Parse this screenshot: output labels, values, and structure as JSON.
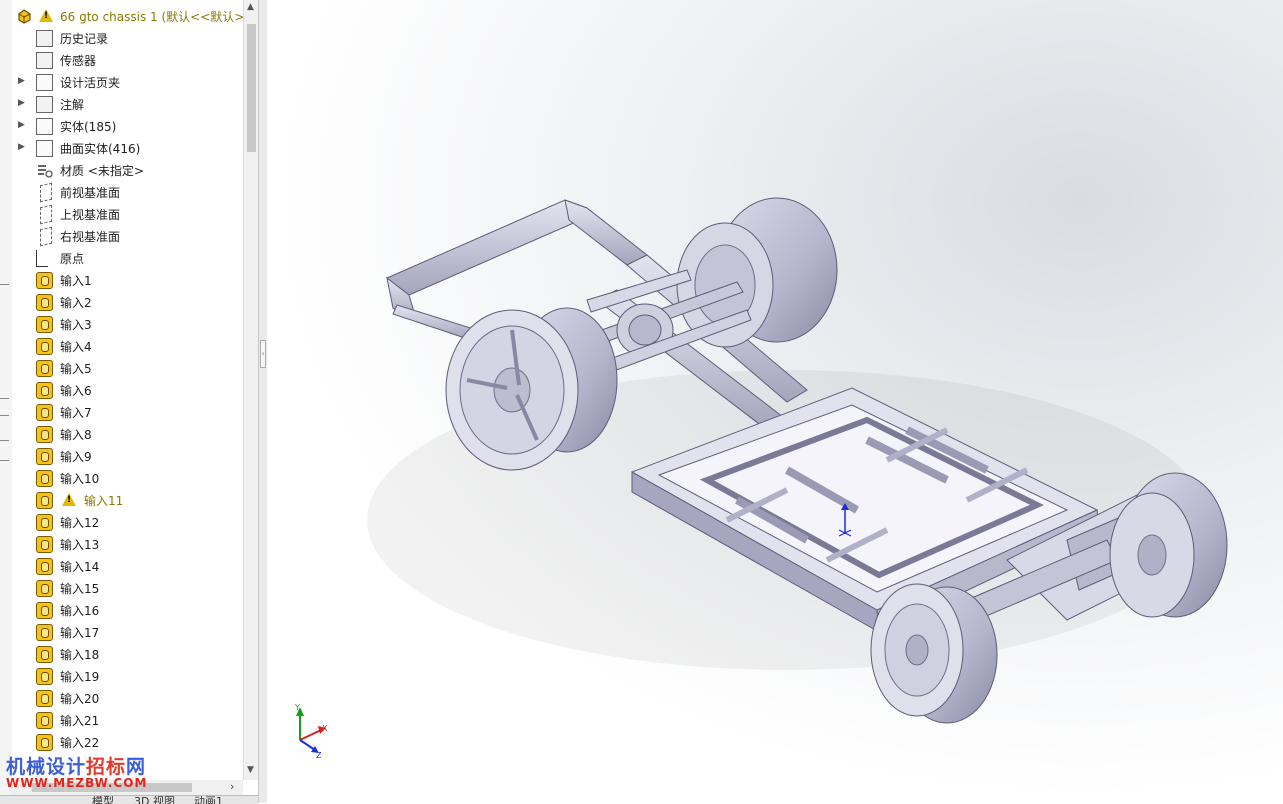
{
  "feature_tree": {
    "root": {
      "label": "66 gto chassis 1  (默认<<默认>"
    },
    "items": [
      {
        "label": "历史记录",
        "icon": "history-icon",
        "arrow": ""
      },
      {
        "label": "传感器",
        "icon": "sensor-icon",
        "arrow": ""
      },
      {
        "label": "设计活页夹",
        "icon": "design-binder-icon",
        "arrow": "▶"
      },
      {
        "label": "注解",
        "icon": "annotation-icon",
        "arrow": "▶"
      },
      {
        "label": "实体(185)",
        "icon": "solid-bodies-icon",
        "arrow": "▶"
      },
      {
        "label": "曲面实体(416)",
        "icon": "surface-bodies-icon",
        "arrow": "▶"
      },
      {
        "label": "材质 <未指定>",
        "icon": "material-icon",
        "arrow": ""
      },
      {
        "label": "前视基准面",
        "icon": "plane-icon",
        "arrow": ""
      },
      {
        "label": "上视基准面",
        "icon": "plane-icon",
        "arrow": ""
      },
      {
        "label": "右视基准面",
        "icon": "plane-icon",
        "arrow": ""
      },
      {
        "label": "原点",
        "icon": "origin-icon",
        "arrow": ""
      },
      {
        "label": "输入1",
        "icon": "import-icon",
        "arrow": ""
      },
      {
        "label": "输入2",
        "icon": "import-icon",
        "arrow": ""
      },
      {
        "label": "输入3",
        "icon": "import-icon",
        "arrow": ""
      },
      {
        "label": "输入4",
        "icon": "import-icon",
        "arrow": ""
      },
      {
        "label": "输入5",
        "icon": "import-icon",
        "arrow": ""
      },
      {
        "label": "输入6",
        "icon": "import-icon",
        "arrow": ""
      },
      {
        "label": "输入7",
        "icon": "import-icon",
        "arrow": ""
      },
      {
        "label": "输入8",
        "icon": "import-icon",
        "arrow": ""
      },
      {
        "label": "输入9",
        "icon": "import-icon",
        "arrow": ""
      },
      {
        "label": "输入10",
        "icon": "import-icon",
        "arrow": ""
      },
      {
        "label": "输入11",
        "icon": "import-icon",
        "arrow": "",
        "warning": true
      },
      {
        "label": "输入12",
        "icon": "import-icon",
        "arrow": ""
      },
      {
        "label": "输入13",
        "icon": "import-icon",
        "arrow": ""
      },
      {
        "label": "输入14",
        "icon": "import-icon",
        "arrow": ""
      },
      {
        "label": "输入15",
        "icon": "import-icon",
        "arrow": ""
      },
      {
        "label": "输入16",
        "icon": "import-icon",
        "arrow": ""
      },
      {
        "label": "输入17",
        "icon": "import-icon",
        "arrow": ""
      },
      {
        "label": "输入18",
        "icon": "import-icon",
        "arrow": ""
      },
      {
        "label": "输入19",
        "icon": "import-icon",
        "arrow": ""
      },
      {
        "label": "输入20",
        "icon": "import-icon",
        "arrow": ""
      },
      {
        "label": "输入21",
        "icon": "import-icon",
        "arrow": ""
      },
      {
        "label": "输入22",
        "icon": "import-icon",
        "arrow": ""
      }
    ]
  },
  "colors": {
    "warning_text": "#8a7a00",
    "model_body": "#c6c6d6",
    "model_dark": "#8e8ea6",
    "triad_x": "#d62020",
    "triad_y": "#12a012",
    "triad_z": "#1c2fd6"
  },
  "bottom_tabs": [
    {
      "label": "模型"
    },
    {
      "label": "3D 视图"
    },
    {
      "label": "动画1"
    }
  ],
  "triad": {
    "x": "X",
    "y": "Y",
    "z": "Z"
  },
  "watermark": {
    "text_blue": "机械设计",
    "text_red": "招标",
    "text_blue2": "网",
    "url": "WWW.MEZBW.COM"
  }
}
